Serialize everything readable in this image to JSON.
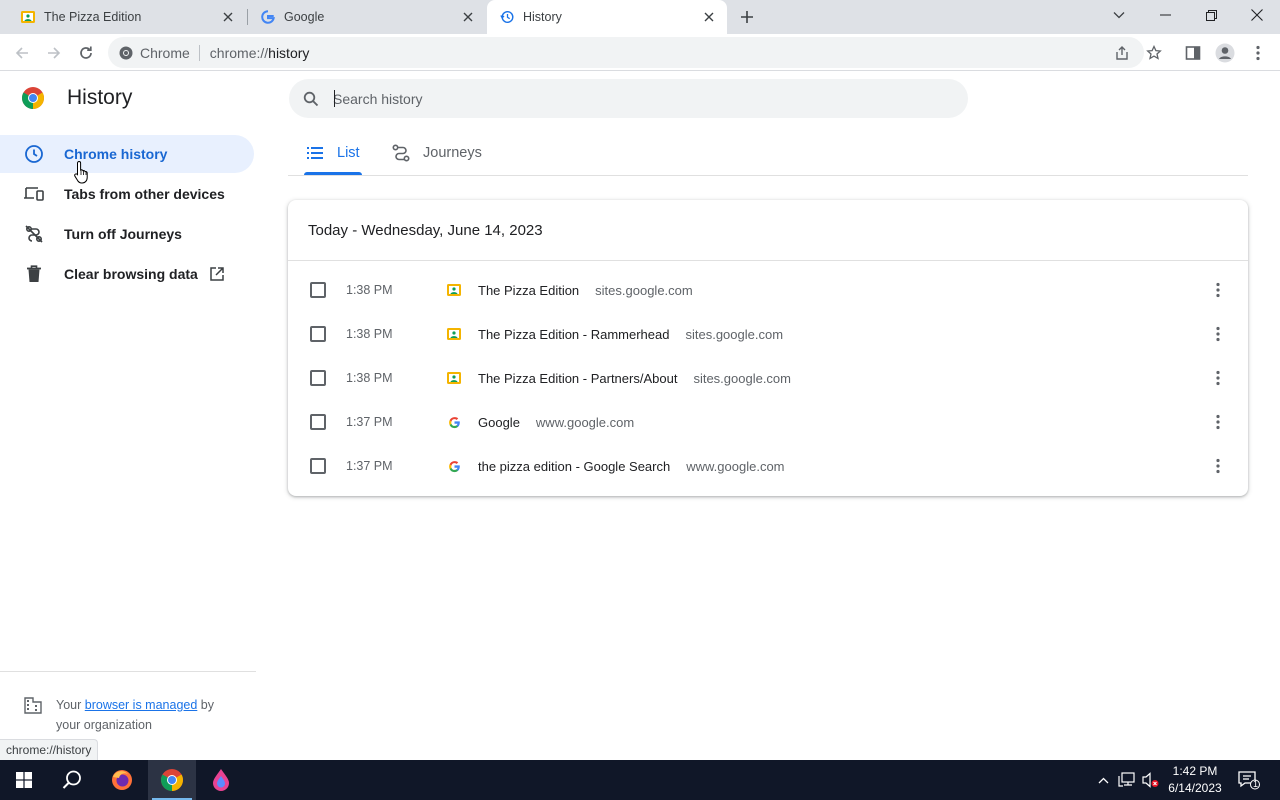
{
  "browser": {
    "tabs": [
      {
        "title": "The Pizza Edition",
        "favicon": "sites-icon",
        "active": false
      },
      {
        "title": "Google",
        "favicon": "google-icon",
        "active": false
      },
      {
        "title": "History",
        "favicon": "history-icon",
        "active": true
      }
    ],
    "omnibox": {
      "site_label": "Chrome",
      "url_scheme": "chrome://",
      "url_host": "history"
    }
  },
  "sidebar": {
    "title": "History",
    "items": [
      {
        "label": "Chrome history",
        "icon": "clock-icon"
      },
      {
        "label": "Tabs from other devices",
        "icon": "devices-icon"
      },
      {
        "label": "Turn off Journeys",
        "icon": "journeys-off-icon"
      },
      {
        "label": "Clear browsing data",
        "icon": "trash-icon"
      }
    ],
    "managed": {
      "prefix": "Your",
      "link": "browser is managed",
      "suffix": "by",
      "line2": "your organization"
    }
  },
  "search": {
    "placeholder": "Search history"
  },
  "view_tabs": [
    {
      "label": "List"
    },
    {
      "label": "Journeys"
    }
  ],
  "history": {
    "date_header": "Today - Wednesday, June 14, 2023",
    "entries": [
      {
        "time": "1:38 PM",
        "title": "The Pizza Edition",
        "domain": "sites.google.com",
        "favicon": "sites-icon"
      },
      {
        "time": "1:38 PM",
        "title": "The Pizza Edition - Rammerhead",
        "domain": "sites.google.com",
        "favicon": "sites-icon"
      },
      {
        "time": "1:38 PM",
        "title": "The Pizza Edition - Partners/About",
        "domain": "sites.google.com",
        "favicon": "sites-icon"
      },
      {
        "time": "1:37 PM",
        "title": "Google",
        "domain": "www.google.com",
        "favicon": "google-icon"
      },
      {
        "time": "1:37 PM",
        "title": "the pizza edition - Google Search",
        "domain": "www.google.com",
        "favicon": "google-icon"
      }
    ]
  },
  "status_bar": {
    "url": "chrome://history"
  },
  "taskbar": {
    "time": "1:42 PM",
    "date": "6/14/2023",
    "notification_count": "1"
  },
  "colors": {
    "accent": "#1a73e8",
    "selected_bg": "#e8f0fe",
    "taskbar": "#101728"
  }
}
